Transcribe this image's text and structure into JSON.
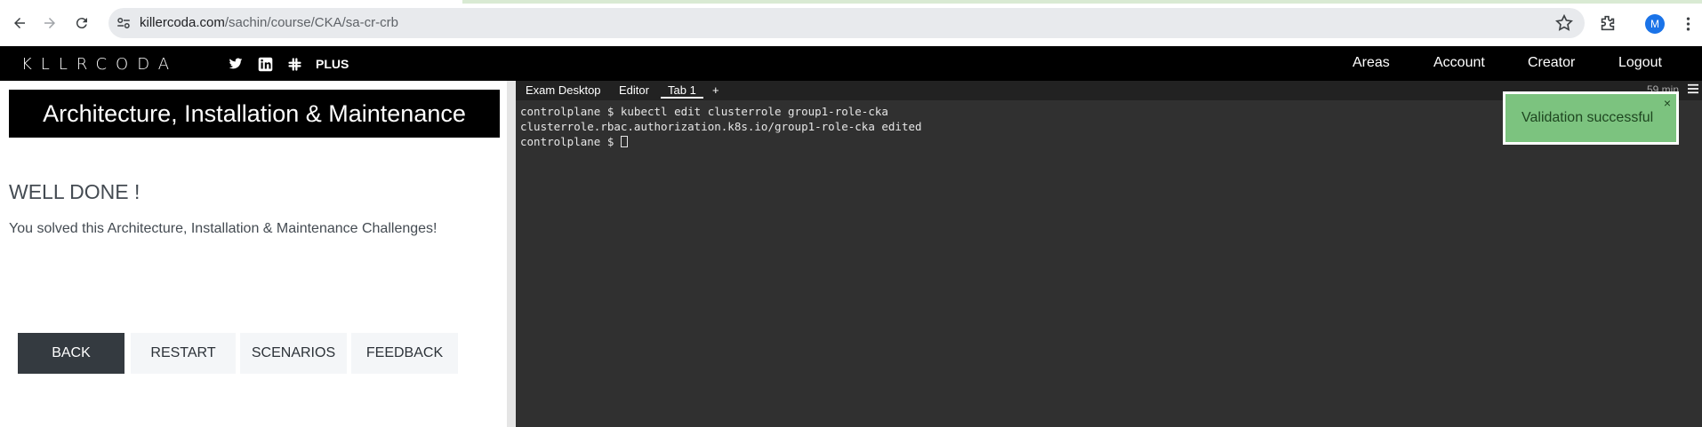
{
  "browser": {
    "url_domain": "killercoda.com",
    "url_path": "/sachin/course/CKA/sa-cr-crb",
    "profile_initial": "M"
  },
  "header": {
    "logo": "KLLRCODA",
    "plus_label": "PLUS",
    "links": [
      "Areas",
      "Account",
      "Creator",
      "Logout"
    ]
  },
  "left": {
    "course_title": "Architecture, Installation & Maintenance",
    "heading": "WELL DONE !",
    "message": "You solved this Architecture, Installation & Maintenance Challenges!",
    "buttons": [
      "BACK",
      "RESTART",
      "SCENARIOS",
      "FEEDBACK"
    ]
  },
  "terminal": {
    "tabs": [
      "Exam Desktop",
      "Editor",
      "Tab 1",
      "+"
    ],
    "timer": "59 min",
    "lines": [
      "controlplane $ kubectl edit clusterrole group1-role-cka",
      "clusterrole.rbac.authorization.k8s.io/group1-role-cka edited",
      "controlplane $ "
    ]
  },
  "toast": {
    "message": "Validation successful",
    "close": "×"
  },
  "colors": {
    "header_bg": "#000000",
    "terminal_bg": "#303030",
    "toast_bg": "#7cc37f",
    "primary_button": "#343a40"
  }
}
